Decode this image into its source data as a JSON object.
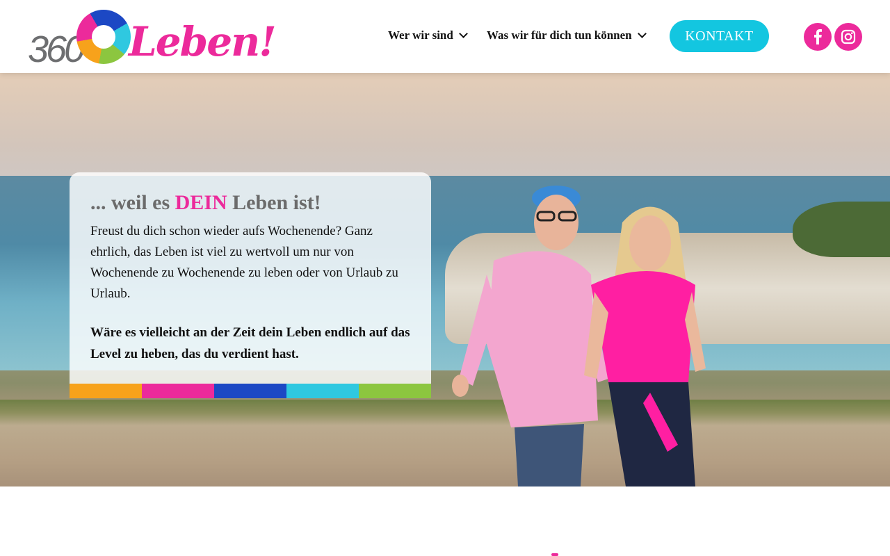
{
  "logo": {
    "number": "360",
    "word": "Leben!",
    "degree": "°"
  },
  "nav": {
    "items": [
      {
        "label": "Wer wir sind"
      },
      {
        "label": "Was wir für dich tun können"
      }
    ],
    "contact_label": "KONTAKT"
  },
  "social": [
    {
      "icon": "facebook-icon",
      "glyph": "f"
    },
    {
      "icon": "instagram-icon"
    }
  ],
  "hero": {
    "title_before": "... weil es ",
    "title_accent": "DEIN",
    "title_after": " Leben ist!",
    "body": "Freust du dich schon wieder aufs Wochenende? Ganz ehrlich, das Leben ist viel zu wertvoll um nur von Wochenende zu Wochenende zu leben oder von Urlaub zu Urlaub.",
    "strong": "Wäre es vielleicht an der Zeit dein Leben endlich auf das Level zu heben, das du verdient hast."
  },
  "colors": {
    "pink": "#ec2a9b",
    "cyan": "#13c6e0",
    "stripes": [
      "#f7a21b",
      "#ec2a9b",
      "#1c48c4",
      "#2fc8e0",
      "#8cc63f"
    ]
  }
}
